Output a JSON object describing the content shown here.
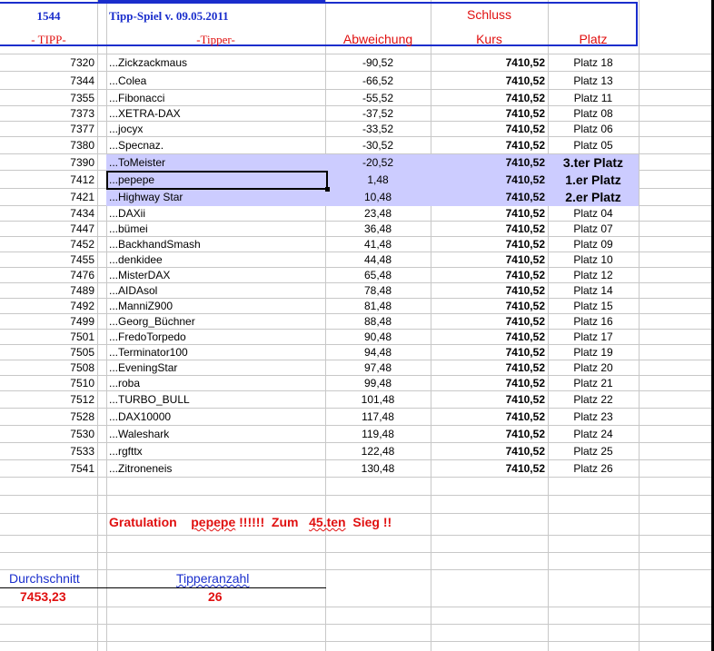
{
  "header": {
    "number": "1544",
    "title": "Tipp-Spiel v. 09.05.2011",
    "schluss": "Schluss",
    "col_tipp": "- TIPP-",
    "col_tipper": "-Tipper-",
    "col_abweichung": "Abweichung",
    "col_kurs": "Kurs",
    "col_platz": "Platz"
  },
  "rows": [
    {
      "tipp": "7320",
      "tipper": "...Zickzackmaus",
      "abw": "-90,52",
      "kurs": "7410,52",
      "platz": "Platz 18"
    },
    {
      "tipp": "7344",
      "tipper": "...Colea",
      "abw": "-66,52",
      "kurs": "7410,52",
      "platz": "Platz 13"
    },
    {
      "tipp": "7355",
      "tipper": "...Fibonacci",
      "abw": "-55,52",
      "kurs": "7410,52",
      "platz": "Platz 11"
    },
    {
      "tipp": "7373",
      "tipper": "...XETRA-DAX",
      "abw": "-37,52",
      "kurs": "7410,52",
      "platz": "Platz 08"
    },
    {
      "tipp": "7377",
      "tipper": "...jocyx",
      "abw": "-33,52",
      "kurs": "7410,52",
      "platz": "Platz 06"
    },
    {
      "tipp": "7380",
      "tipper": "...Specnaz.",
      "abw": "-30,52",
      "kurs": "7410,52",
      "platz": "Platz 05"
    },
    {
      "tipp": "7390",
      "tipper": "...ToMeister",
      "abw": "-20,52",
      "kurs": "7410,52",
      "platz": "3.ter Platz"
    },
    {
      "tipp": "7412",
      "tipper": "...pepepe",
      "abw": "1,48",
      "kurs": "7410,52",
      "platz": "1.er Platz"
    },
    {
      "tipp": "7421",
      "tipper": "...Highway Star",
      "abw": "10,48",
      "kurs": "7410,52",
      "platz": "2.er Platz"
    },
    {
      "tipp": "7434",
      "tipper": "...DAXii",
      "abw": "23,48",
      "kurs": "7410,52",
      "platz": "Platz 04"
    },
    {
      "tipp": "7447",
      "tipper": "...bümei",
      "abw": "36,48",
      "kurs": "7410,52",
      "platz": "Platz 07"
    },
    {
      "tipp": "7452",
      "tipper": "...BackhandSmash",
      "abw": "41,48",
      "kurs": "7410,52",
      "platz": "Platz 09"
    },
    {
      "tipp": "7455",
      "tipper": "...denkidee",
      "abw": "44,48",
      "kurs": "7410,52",
      "platz": "Platz 10"
    },
    {
      "tipp": "7476",
      "tipper": "...MisterDAX",
      "abw": "65,48",
      "kurs": "7410,52",
      "platz": "Platz 12"
    },
    {
      "tipp": "7489",
      "tipper": "...AIDAsol",
      "abw": "78,48",
      "kurs": "7410,52",
      "platz": "Platz 14"
    },
    {
      "tipp": "7492",
      "tipper": "...ManniZ900",
      "abw": "81,48",
      "kurs": "7410,52",
      "platz": "Platz 15"
    },
    {
      "tipp": "7499",
      "tipper": "...Georg_Büchner",
      "abw": "88,48",
      "kurs": "7410,52",
      "platz": "Platz 16"
    },
    {
      "tipp": "7501",
      "tipper": "...FredoTorpedo",
      "abw": "90,48",
      "kurs": "7410,52",
      "platz": "Platz 17"
    },
    {
      "tipp": "7505",
      "tipper": "...Terminator100",
      "abw": "94,48",
      "kurs": "7410,52",
      "platz": "Platz 19"
    },
    {
      "tipp": "7508",
      "tipper": "...EveningStar",
      "abw": "97,48",
      "kurs": "7410,52",
      "platz": "Platz 20"
    },
    {
      "tipp": "7510",
      "tipper": "...roba",
      "abw": "99,48",
      "kurs": "7410,52",
      "platz": "Platz 21"
    },
    {
      "tipp": "7512",
      "tipper": "...TURBO_BULL",
      "abw": "101,48",
      "kurs": "7410,52",
      "platz": "Platz 22"
    },
    {
      "tipp": "7528",
      "tipper": "...DAX10000",
      "abw": "117,48",
      "kurs": "7410,52",
      "platz": "Platz 23"
    },
    {
      "tipp": "7530",
      "tipper": "...Waleshark",
      "abw": "119,48",
      "kurs": "7410,52",
      "platz": "Platz 24"
    },
    {
      "tipp": "7533",
      "tipper": "...rgfttx",
      "abw": "122,48",
      "kurs": "7410,52",
      "platz": "Platz 25"
    },
    {
      "tipp": "7541",
      "tipper": "...Zitroneneis",
      "abw": "130,48",
      "kurs": "7410,52",
      "platz": "Platz 26"
    }
  ],
  "congrats": {
    "part1": "Gratulation",
    "name": "pepepe",
    "part2": "!!!!!!  Zum",
    "count": "45.ten",
    "part3": "Sieg !!"
  },
  "footer": {
    "durchschnitt_label": "Durchschnitt",
    "durchschnitt_value": "7453,23",
    "tipperanzahl_label": "Tipperanzahl",
    "tipperanzahl_value": "26"
  },
  "colors": {
    "accent_blue": "#1a2ecc",
    "accent_red": "#e01010",
    "highlight": "#ccccff"
  }
}
